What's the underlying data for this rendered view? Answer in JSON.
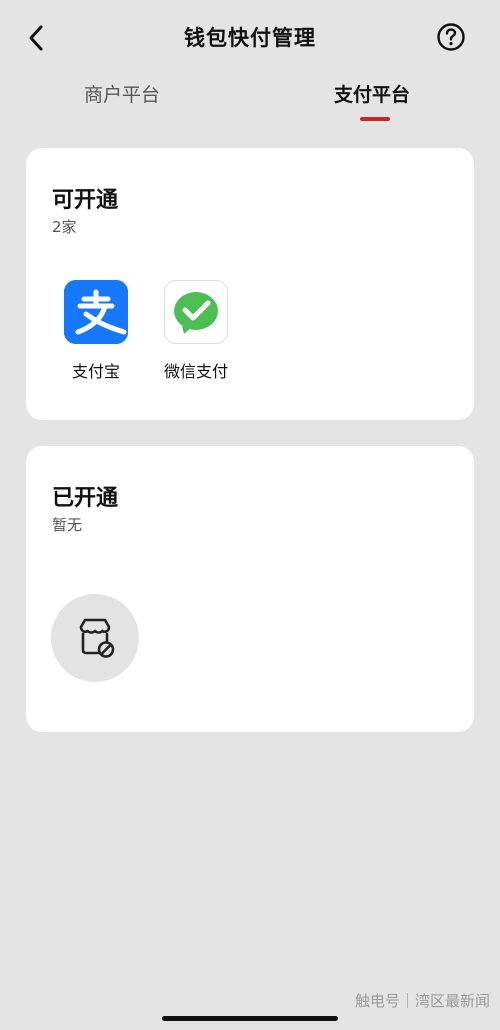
{
  "header": {
    "title": "钱包快付管理",
    "back_icon": "chevron-left-icon",
    "help_icon": "question-circle-icon"
  },
  "tabs": [
    {
      "label": "商户平台",
      "active": false
    },
    {
      "label": "支付平台",
      "active": true
    }
  ],
  "accent_color": "#c62828",
  "available": {
    "title": "可开通",
    "count": "2家",
    "items": [
      {
        "label": "支付宝",
        "icon": "alipay-icon",
        "color": "#1677ff"
      },
      {
        "label": "微信支付",
        "icon": "wechat-pay-icon",
        "color": "#4cbf54"
      }
    ]
  },
  "enabled": {
    "title": "已开通",
    "subtitle": "暂无",
    "icon": "store-disabled-icon"
  },
  "watermark": "触电号｜湾区最新闻"
}
